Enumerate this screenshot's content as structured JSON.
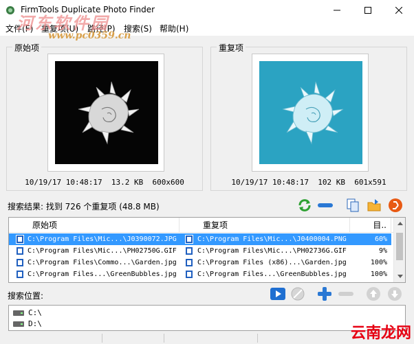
{
  "window": {
    "title": "FirmTools Duplicate Photo Finder"
  },
  "watermark": {
    "text": "河东软件园",
    "url": "www.pc0359.cn"
  },
  "menu": {
    "items": [
      "文件(F)",
      "重复项(U)",
      "路径(P)",
      "搜索(S)",
      "帮助(H)"
    ]
  },
  "original_panel": {
    "legend": "原始项",
    "info": "10/19/17 10:48:17  13.2 KB  600x600"
  },
  "duplicate_panel": {
    "legend": "重复项",
    "info": "10/19/17 10:48:17  102 KB  601x591"
  },
  "results": {
    "label": "搜索结果: 找到 726 个重复项 (48.8 MB)"
  },
  "table": {
    "headers": {
      "original": "原始项",
      "duplicate": "重复项",
      "similarity": "目.."
    },
    "rows": [
      {
        "original": "C:\\Program Files\\Mic...\\J0390072.JPG",
        "duplicate": "C:\\Program Files\\Mic...\\J0400004.PNG",
        "similarity": "60%",
        "selected": true
      },
      {
        "original": "C:\\Program Files\\Mic...\\PH02750G.GIF",
        "duplicate": "C:\\Program Files\\Mic...\\PH02736G.GIF",
        "similarity": "9%",
        "selected": false
      },
      {
        "original": "C:\\Program Files\\Commo...\\Garden.jpg",
        "duplicate": "C:\\Program Files (x86)...\\Garden.jpg",
        "similarity": "100%",
        "selected": false
      },
      {
        "original": "C:\\Program Files...\\GreenBubbles.jpg",
        "duplicate": "C:\\Program Files...\\GreenBubbles.jpg",
        "similarity": "100%",
        "selected": false
      }
    ]
  },
  "search_locations": {
    "label": "搜索位置:",
    "items": [
      "C:\\",
      "D:\\"
    ]
  },
  "brand": {
    "text": "云南龙网"
  },
  "colors": {
    "selection": "#3399ff",
    "right_photo_bg": "#2ba3c2",
    "left_photo_bg": "#050505"
  }
}
